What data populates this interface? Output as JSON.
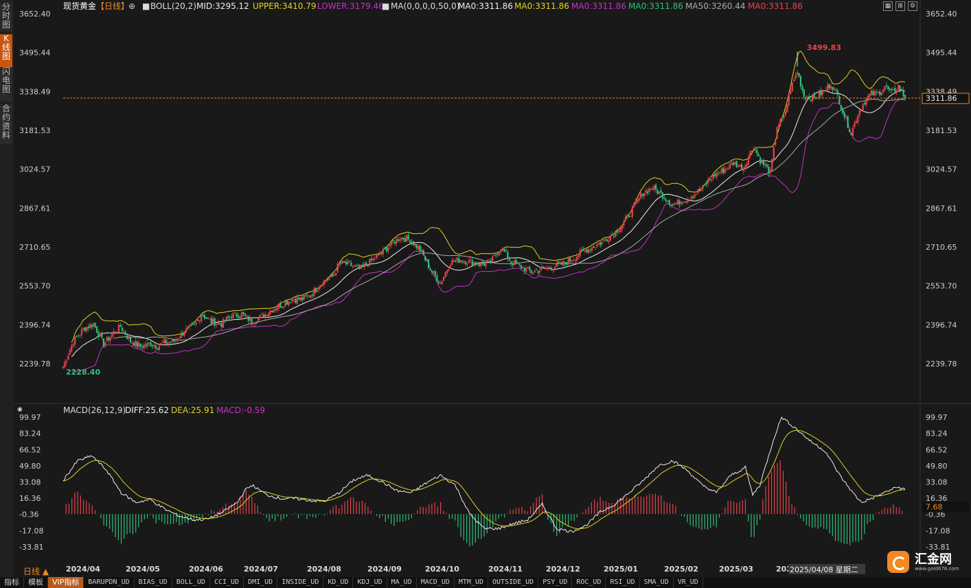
{
  "left_tabs": [
    {
      "label": "分时图",
      "active": false
    },
    {
      "label": "K线图",
      "active": true
    },
    {
      "label": "闪电图",
      "active": false
    },
    {
      "label": "合约资料",
      "active": false
    }
  ],
  "header": {
    "symbol": "现货黄金",
    "period": "【日线】",
    "plus": "⊕",
    "boll": "BOLL(20,2)",
    "mid": "MID:3295.12",
    "upper": "UPPER:3410.79",
    "lower": "LOWER:3179.46",
    "ma_def": "MA(0,0,0,0,50,0)",
    "ma1": "MA0:3311.86",
    "ma2": "MA0:3311.86",
    "ma3": "MA0:3311.86",
    "ma4": "MA0:3311.86",
    "ma50": "MA50:3260.44",
    "ma6": "MA0:3311.86"
  },
  "macd_header": {
    "def": "MACD(26,12,9)",
    "diff": "DIFF:25.62",
    "dea": "DEA:25.91",
    "macd": "MACD:-0.59"
  },
  "colors": {
    "bg": "#191919",
    "up": "#e8434b",
    "down": "#2ec27a",
    "upper": "#e6d321",
    "mid": "#f0f0f0",
    "lower": "#c930c9",
    "ma50": "#aaaaaa",
    "price": "#f08a24"
  },
  "current_price": "3311.86",
  "macd_current": "7.68",
  "max_label": "3499.83",
  "min_label": "2228.40",
  "bottom_left": "日线 ▲",
  "crosshair_date": "2025/04/08 星期二",
  "logo": {
    "name": "汇金网",
    "url": "www.gold678.com"
  },
  "bottom_tabs": [
    "指标",
    "模板",
    "VIP指标",
    "BARUPDN_UD",
    "BIAS_UD",
    "BOLL_UD",
    "CCI_UD",
    "DMI_UD",
    "INSIDE_UD",
    "KD_UD",
    "KDJ_UD",
    "MA_UD",
    "MACD_UD",
    "MTM_UD",
    "OUTSIDE_UD",
    "PSY_UD",
    "ROC_UD",
    "RSI_UD",
    "SMA_UD",
    "VR_UD"
  ],
  "chart_data": [
    {
      "type": "candlestick",
      "title": "现货黄金 日线",
      "ylim": [
        2200,
        3670
      ],
      "yticks": [
        "3652.40",
        "3495.44",
        "3338.49",
        "3181.53",
        "3024.57",
        "2867.61",
        "2710.65",
        "2553.70",
        "2396.74",
        "2239.78"
      ],
      "xticks": [
        "2024/04",
        "2024/05",
        "2024/06",
        "2024/07",
        "2024/08",
        "2024/09",
        "2024/10",
        "2024/11",
        "2024/12",
        "2025/01",
        "2025/02",
        "2025/03",
        "2025/04"
      ],
      "price_anchors": [
        [
          0,
          2228
        ],
        [
          6,
          2330
        ],
        [
          12,
          2380
        ],
        [
          18,
          2400
        ],
        [
          24,
          2320
        ],
        [
          30,
          2365
        ],
        [
          34,
          2390
        ],
        [
          40,
          2330
        ],
        [
          46,
          2310
        ],
        [
          52,
          2320
        ],
        [
          56,
          2310
        ],
        [
          60,
          2325
        ],
        [
          66,
          2330
        ],
        [
          72,
          2370
        ],
        [
          78,
          2390
        ],
        [
          82,
          2440
        ],
        [
          88,
          2410
        ],
        [
          94,
          2400
        ],
        [
          100,
          2435
        ],
        [
          106,
          2440
        ],
        [
          112,
          2410
        ],
        [
          118,
          2430
        ],
        [
          124,
          2460
        ],
        [
          130,
          2480
        ],
        [
          136,
          2500
        ],
        [
          142,
          2500
        ],
        [
          148,
          2525
        ],
        [
          154,
          2570
        ],
        [
          160,
          2590
        ],
        [
          164,
          2645
        ],
        [
          170,
          2640
        ],
        [
          176,
          2620
        ],
        [
          182,
          2650
        ],
        [
          188,
          2680
        ],
        [
          194,
          2720
        ],
        [
          200,
          2750
        ],
        [
          206,
          2740
        ],
        [
          212,
          2700
        ],
        [
          218,
          2620
        ],
        [
          224,
          2565
        ],
        [
          230,
          2650
        ],
        [
          236,
          2660
        ],
        [
          242,
          2650
        ],
        [
          248,
          2640
        ],
        [
          254,
          2650
        ],
        [
          260,
          2710
        ],
        [
          266,
          2650
        ],
        [
          272,
          2630
        ],
        [
          278,
          2610
        ],
        [
          284,
          2620
        ],
        [
          290,
          2630
        ],
        [
          296,
          2640
        ],
        [
          302,
          2660
        ],
        [
          308,
          2690
        ],
        [
          314,
          2710
        ],
        [
          320,
          2730
        ],
        [
          326,
          2760
        ],
        [
          332,
          2800
        ],
        [
          338,
          2860
        ],
        [
          344,
          2930
        ],
        [
          350,
          2950
        ],
        [
          356,
          2920
        ],
        [
          362,
          2880
        ],
        [
          368,
          2900
        ],
        [
          374,
          2920
        ],
        [
          380,
          2950
        ],
        [
          386,
          3000
        ],
        [
          392,
          3020
        ],
        [
          398,
          3050
        ],
        [
          404,
          3030
        ],
        [
          410,
          3120
        ],
        [
          414,
          3060
        ],
        [
          420,
          3010
        ],
        [
          424,
          3200
        ],
        [
          428,
          3230
        ],
        [
          432,
          3350
        ],
        [
          436,
          3420
        ],
        [
          440,
          3320
        ],
        [
          446,
          3310
        ],
        [
          452,
          3340
        ],
        [
          456,
          3370
        ],
        [
          460,
          3320
        ],
        [
          464,
          3240
        ],
        [
          468,
          3170
        ],
        [
          472,
          3250
        ],
        [
          476,
          3300
        ],
        [
          480,
          3330
        ],
        [
          484,
          3330
        ],
        [
          488,
          3360
        ],
        [
          492,
          3330
        ],
        [
          496,
          3360
        ],
        [
          500,
          3312
        ]
      ],
      "max": 3499.83,
      "min": 2228.4,
      "last": 3311.86,
      "boll": {
        "mid": 3295.12,
        "upper": 3410.79,
        "lower": 3179.46
      },
      "ma50": 3260.44
    },
    {
      "type": "macd",
      "ylim": [
        -45,
        105
      ],
      "yticks": [
        "99.97",
        "83.24",
        "66.52",
        "49.80",
        "33.08",
        "16.36",
        "-0.36",
        "-17.08",
        "-33.81"
      ],
      "diff_anchors": [
        [
          0,
          35
        ],
        [
          10,
          55
        ],
        [
          20,
          60
        ],
        [
          30,
          45
        ],
        [
          40,
          22
        ],
        [
          50,
          12
        ],
        [
          60,
          15
        ],
        [
          70,
          5
        ],
        [
          80,
          -2
        ],
        [
          90,
          -6
        ],
        [
          100,
          -5
        ],
        [
          110,
          2
        ],
        [
          120,
          12
        ],
        [
          125,
          24
        ],
        [
          130,
          30
        ],
        [
          140,
          20
        ],
        [
          150,
          16
        ],
        [
          160,
          16
        ],
        [
          170,
          14
        ],
        [
          180,
          13
        ],
        [
          190,
          22
        ],
        [
          200,
          35
        ],
        [
          210,
          40
        ],
        [
          220,
          33
        ],
        [
          230,
          24
        ],
        [
          240,
          22
        ],
        [
          250,
          32
        ],
        [
          260,
          40
        ],
        [
          270,
          30
        ],
        [
          280,
          0
        ],
        [
          290,
          -15
        ],
        [
          300,
          -15
        ],
        [
          310,
          -10
        ],
        [
          320,
          -6
        ],
        [
          330,
          10
        ],
        [
          340,
          -15
        ],
        [
          350,
          -18
        ],
        [
          360,
          -12
        ],
        [
          370,
          2
        ],
        [
          380,
          10
        ],
        [
          390,
          22
        ],
        [
          400,
          35
        ],
        [
          410,
          50
        ],
        [
          420,
          55
        ],
        [
          430,
          45
        ],
        [
          440,
          30
        ],
        [
          450,
          22
        ],
        [
          460,
          40
        ],
        [
          470,
          48
        ],
        [
          475,
          20
        ],
        [
          480,
          30
        ],
        [
          490,
          80
        ],
        [
          495,
          100
        ],
        [
          505,
          88
        ],
        [
          515,
          75
        ],
        [
          525,
          65
        ],
        [
          535,
          40
        ],
        [
          545,
          20
        ],
        [
          550,
          12
        ],
        [
          560,
          18
        ],
        [
          570,
          25
        ],
        [
          575,
          28
        ],
        [
          580,
          25
        ]
      ],
      "dea": 25.91,
      "diff": 25.62,
      "macd": -0.59
    }
  ]
}
